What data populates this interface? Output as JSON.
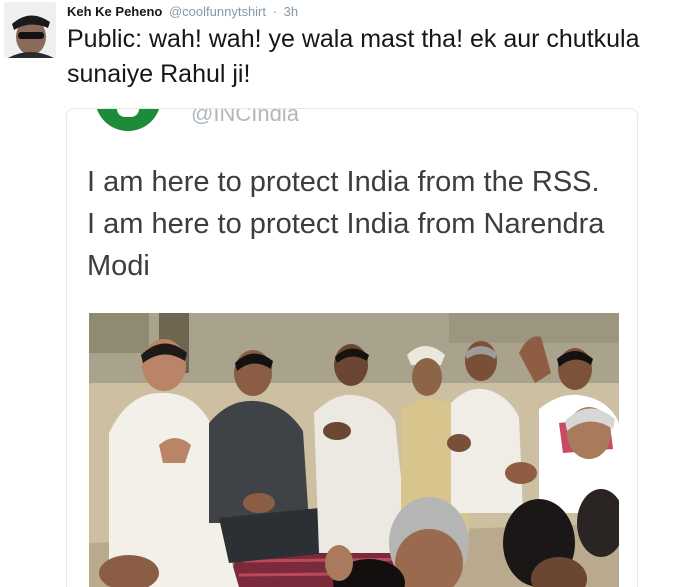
{
  "tweet": {
    "author_name": "Keh Ke Peheno",
    "author_handle": "@coolfunnytshirt",
    "separator": "·",
    "timestamp": "3h",
    "text": "Public: wah! wah! ye wala mast tha! ek aur chutkula sunaiye Rahul ji!"
  },
  "quoted_tweet": {
    "handle": "@INCIndia",
    "text": "I am here to protect India from the RSS. I am here to protect India from Narendra Modi"
  },
  "colors": {
    "text": "#14171a",
    "muted": "#8899a6",
    "card_border": "#e1e8ed",
    "congress_green": "#1d8b3a"
  },
  "icons": {
    "avatar": "user-avatar-image",
    "quoted_logo": "inc-party-logo",
    "photo": "group-photo-image"
  }
}
